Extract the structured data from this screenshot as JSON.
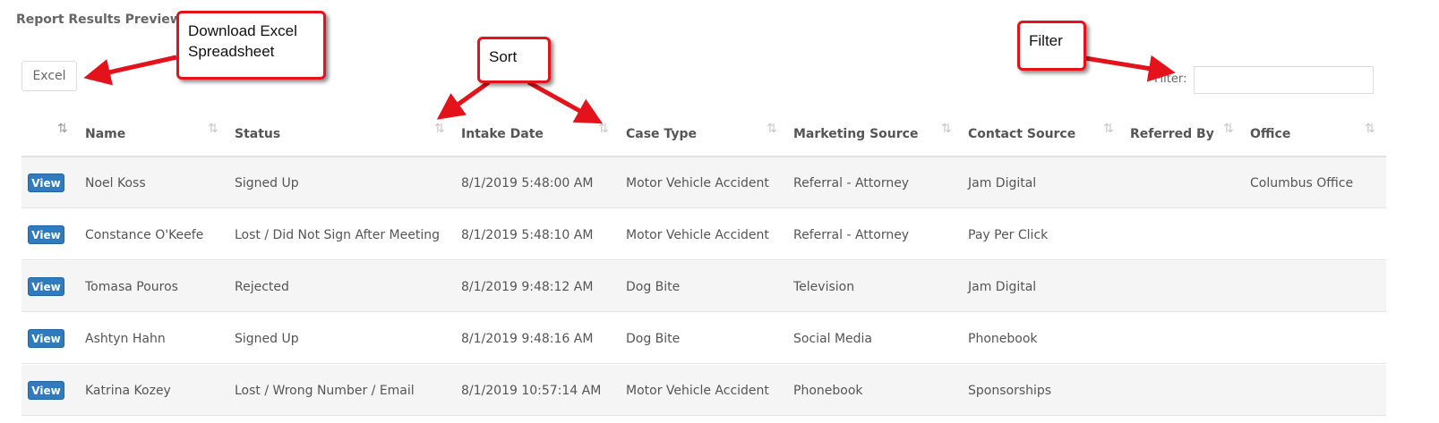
{
  "page": {
    "title": "Report Results Preview"
  },
  "toolbar": {
    "excel_label": "Excel",
    "filter_label": "Filter:",
    "filter_value": ""
  },
  "table": {
    "columns": [
      "Name",
      "Status",
      "Intake Date",
      "Case Type",
      "Marketing Source",
      "Contact Source",
      "Referred By",
      "Office"
    ],
    "view_label": "View",
    "rows": [
      [
        "Noel Koss",
        "Signed Up",
        "8/1/2019 5:48:00 AM",
        "Motor Vehicle Accident",
        "Referral - Attorney",
        "Jam Digital",
        "",
        "Columbus Office"
      ],
      [
        "Constance O'Keefe",
        "Lost / Did Not Sign After Meeting",
        "8/1/2019 5:48:10 AM",
        "Motor Vehicle Accident",
        "Referral - Attorney",
        "Pay Per Click",
        "",
        ""
      ],
      [
        "Tomasa Pouros",
        "Rejected",
        "8/1/2019 9:48:12 AM",
        "Dog Bite",
        "Television",
        "Jam Digital",
        "",
        ""
      ],
      [
        "Ashtyn Hahn",
        "Signed Up",
        "8/1/2019 9:48:16 AM",
        "Dog Bite",
        "Social Media",
        "Phonebook",
        "",
        ""
      ],
      [
        "Katrina Kozey",
        "Lost / Wrong Number / Email",
        "8/1/2019 10:57:14 AM",
        "Motor Vehicle Accident",
        "Phonebook",
        "Sponsorships",
        "",
        ""
      ]
    ]
  },
  "annotations": {
    "excel": [
      "Download Excel",
      "Spreadsheet"
    ],
    "sort": "Sort",
    "filter": "Filter"
  },
  "colors": {
    "callout_border": "#e3121b",
    "view_button": "#2f7bbf"
  },
  "icons": {
    "sort": "sort-arrows-icon",
    "sort_active": "sort-ascending-icon"
  }
}
